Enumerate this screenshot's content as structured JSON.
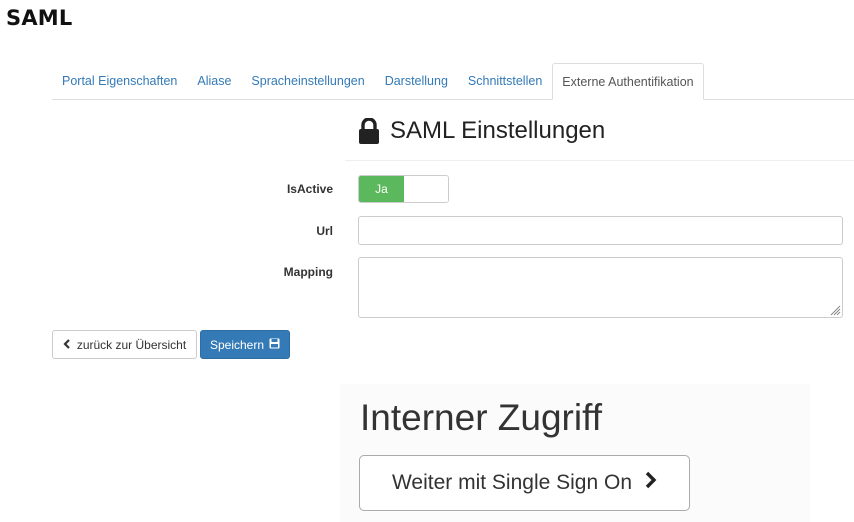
{
  "page": {
    "title": "SAML"
  },
  "tabs": [
    {
      "label": "Portal Eigenschaften",
      "active": false
    },
    {
      "label": "Aliase",
      "active": false
    },
    {
      "label": "Spracheinstellungen",
      "active": false
    },
    {
      "label": "Darstellung",
      "active": false
    },
    {
      "label": "Schnittstellen",
      "active": false
    },
    {
      "label": "Externe Authentifikation",
      "active": true
    }
  ],
  "panel": {
    "title": "SAML Einstellungen",
    "icon": "lock-icon"
  },
  "form": {
    "is_active": {
      "label": "IsActive",
      "toggle_label": "Ja",
      "value": true,
      "on_color": "#5cb85c"
    },
    "url": {
      "label": "Url",
      "value": "",
      "placeholder": ""
    },
    "mapping": {
      "label": "Mapping",
      "value": "",
      "placeholder": ""
    }
  },
  "actions": {
    "back_label": "zurück zur Übersicht",
    "back_icon": "chevron-left-icon",
    "save_label": "Speichern",
    "save_icon": "floppy-disk-icon",
    "save_color": "#337ab7"
  },
  "sso": {
    "heading": "Interner Zugriff",
    "button_label": "Weiter mit Single Sign On",
    "button_icon": "chevron-right-icon"
  }
}
